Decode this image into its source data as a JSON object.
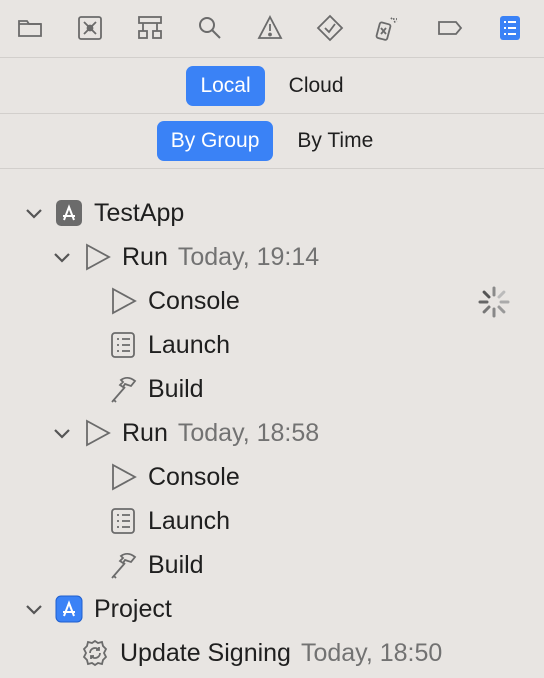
{
  "toolbar": {
    "icons": [
      "folder-icon",
      "source-control-icon",
      "hierarchy-icon",
      "search-icon",
      "warning-icon",
      "test-icon",
      "debug-icon",
      "breakpoint-icon",
      "report-icon"
    ]
  },
  "location_toggle": {
    "local": "Local",
    "cloud": "Cloud",
    "selected": "Local"
  },
  "sort_toggle": {
    "by_group": "By Group",
    "by_time": "By Time",
    "selected": "By Group"
  },
  "tree": {
    "testapp": "TestApp",
    "run1": {
      "label": "Run",
      "time": "Today, 19:14"
    },
    "run1_console": "Console",
    "run1_launch": "Launch",
    "run1_build": "Build",
    "run2": {
      "label": "Run",
      "time": "Today, 18:58"
    },
    "run2_console": "Console",
    "run2_launch": "Launch",
    "run2_build": "Build",
    "project": "Project",
    "update_signing": {
      "label": "Update Signing",
      "time": "Today, 18:50"
    }
  },
  "colors": {
    "accent": "#3a82f6",
    "background": "#e8e5e2",
    "secondary_text": "#727272"
  }
}
